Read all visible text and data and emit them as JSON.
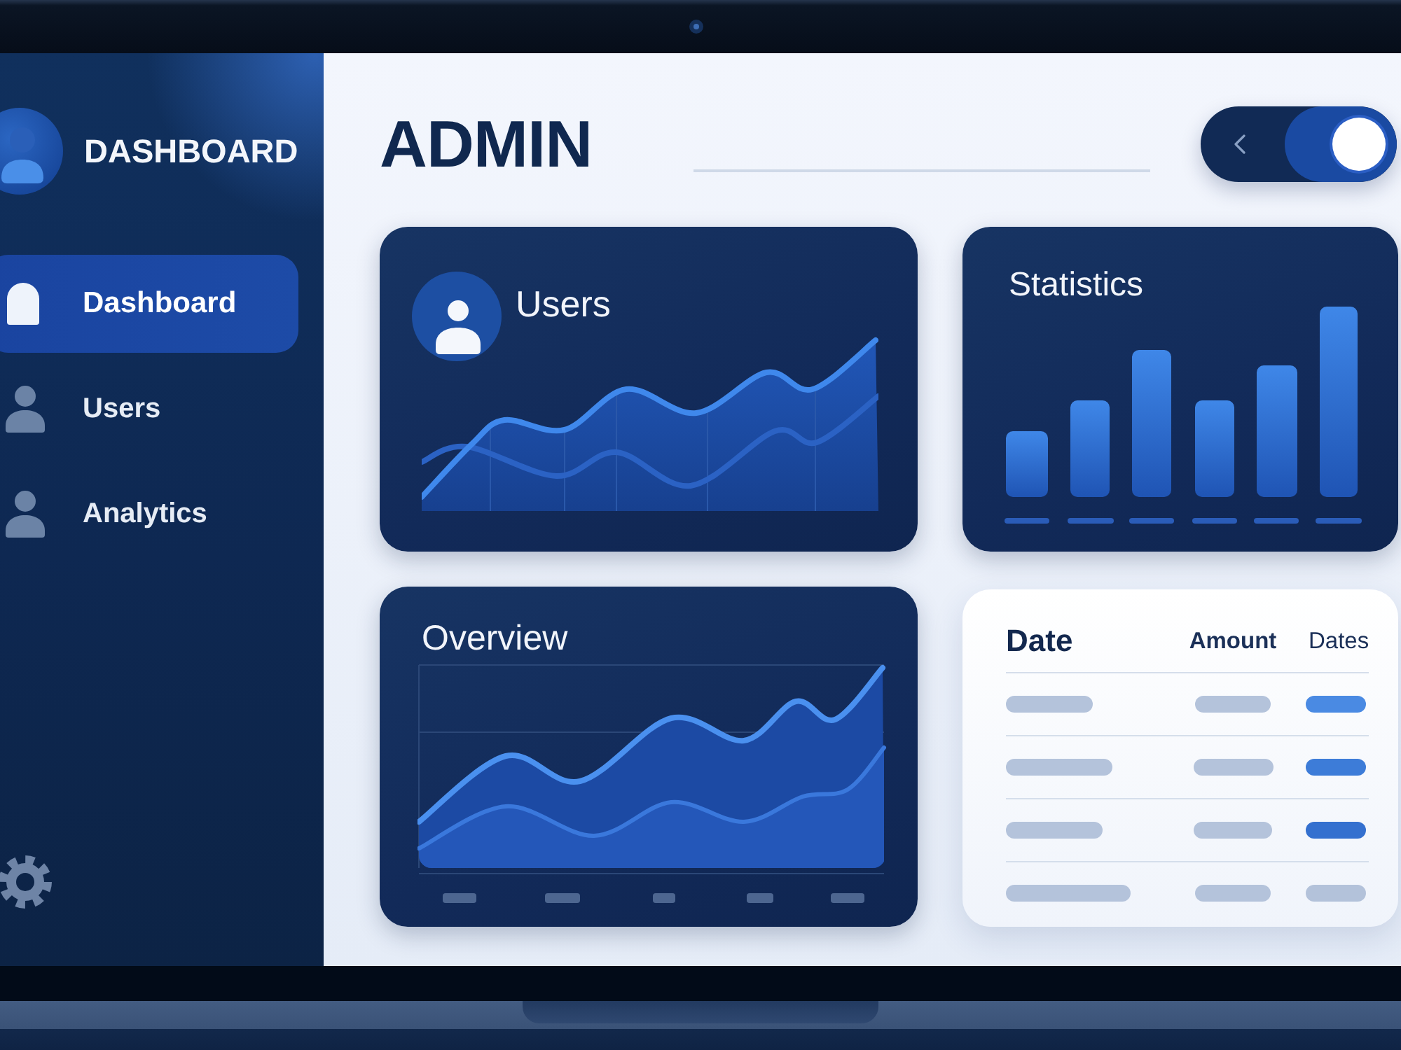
{
  "sidebar": {
    "brand": "DASHBOARD",
    "items": [
      {
        "label": "Dashboard",
        "selected": true
      },
      {
        "label": "Users",
        "selected": false
      },
      {
        "label": "Analytics",
        "selected": false
      }
    ]
  },
  "header": {
    "title": "ADMIN",
    "toggle": {
      "on": true
    }
  },
  "cards": [
    {
      "kind": "area",
      "title": "Users"
    },
    {
      "kind": "bars",
      "title": "Statistics"
    },
    {
      "kind": "overview",
      "title": "Overview"
    },
    {
      "kind": "table",
      "columns": [
        "Date",
        "Amount",
        "Dates"
      ],
      "rows": [
        {
          "color": "#4a8ae3"
        },
        {
          "color": "#3d7cd8"
        },
        {
          "color": "#3470cf"
        },
        {
          "color": "#b3c2da"
        }
      ]
    }
  ]
}
